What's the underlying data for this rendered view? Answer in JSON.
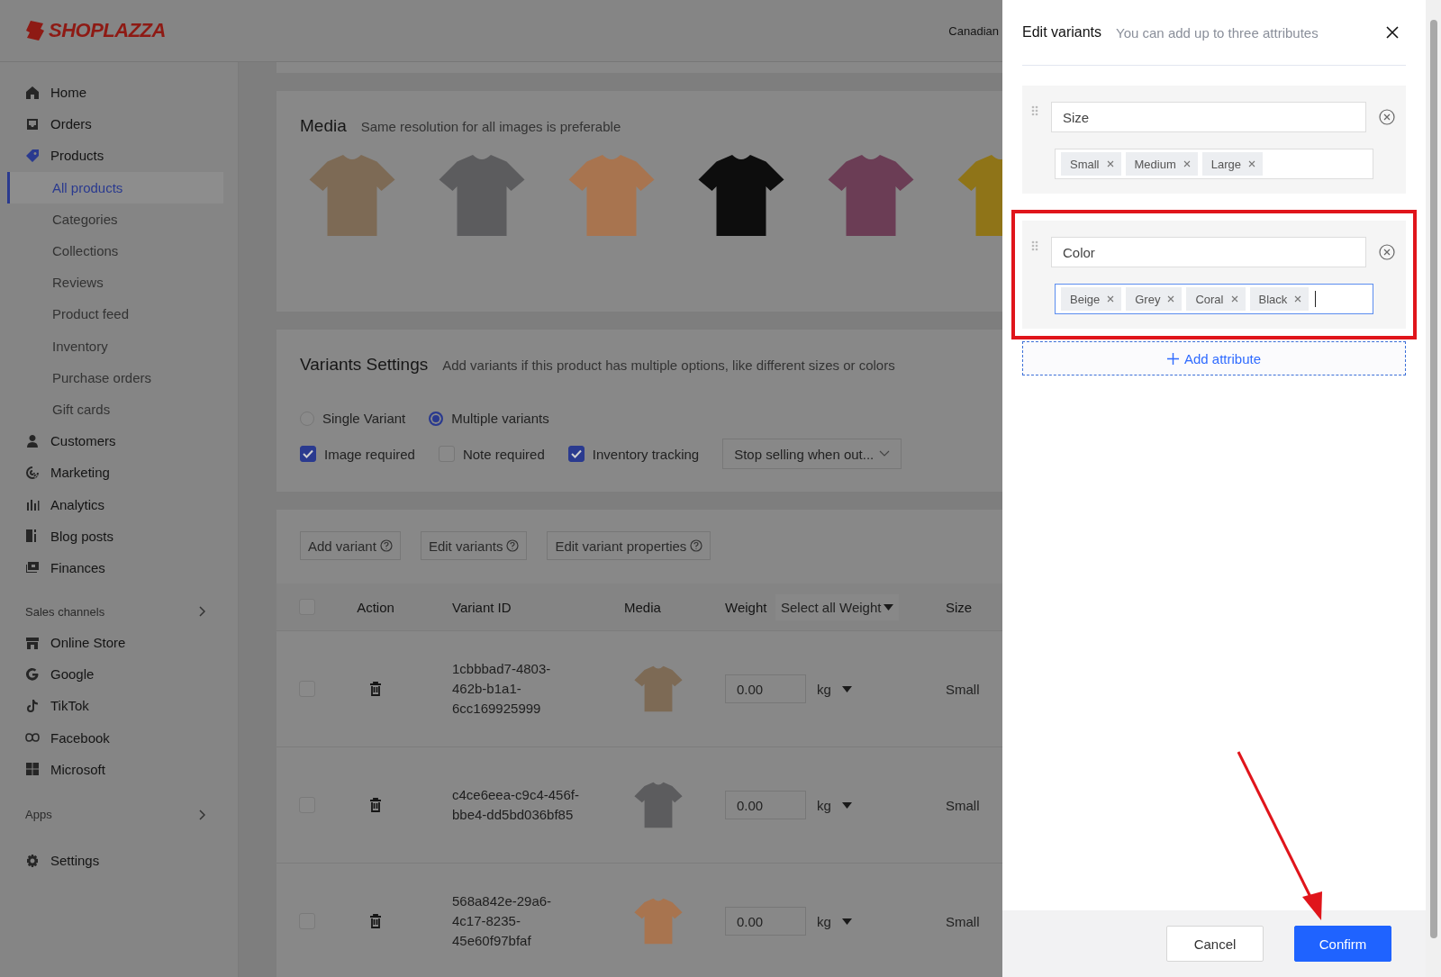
{
  "header": {
    "logo": "SHOPLAZZA",
    "store_name": "Canadian"
  },
  "sidebar": {
    "items": [
      {
        "label": "Home",
        "selected": false
      },
      {
        "label": "Orders",
        "selected": false
      },
      {
        "label": "Products",
        "selected": false,
        "children": [
          {
            "label": "All products",
            "selected": true
          },
          {
            "label": "Categories",
            "selected": false
          },
          {
            "label": "Collections",
            "selected": false
          },
          {
            "label": "Reviews",
            "selected": false
          },
          {
            "label": "Product feed",
            "selected": false
          },
          {
            "label": "Inventory",
            "selected": false
          },
          {
            "label": "Purchase orders",
            "selected": false
          },
          {
            "label": "Gift cards",
            "selected": false
          }
        ]
      },
      {
        "label": "Customers",
        "selected": false
      },
      {
        "label": "Marketing",
        "selected": false
      },
      {
        "label": "Analytics",
        "selected": false
      },
      {
        "label": "Blog posts",
        "selected": false
      },
      {
        "label": "Finances",
        "selected": false
      }
    ],
    "sales_channels": {
      "title": "Sales channels",
      "items": [
        {
          "label": "Online Store",
          "selected": false
        },
        {
          "label": "Google",
          "selected": false
        },
        {
          "label": "TikTok",
          "selected": false
        },
        {
          "label": "Facebook",
          "selected": false
        },
        {
          "label": "Microsoft",
          "selected": false
        }
      ]
    },
    "apps": {
      "title": "Apps"
    },
    "settings": {
      "label": "Settings",
      "selected": false
    }
  },
  "media": {
    "title": "Media",
    "hint": "Same resolution for all images is preferable",
    "images": [
      {
        "color": "#7d6a55"
      },
      {
        "color": "#5c5c5e"
      },
      {
        "color": "#a8744f"
      },
      {
        "color": "#0d0d0d"
      },
      {
        "color": "#6b3d55"
      },
      {
        "color": "#8f7418"
      }
    ]
  },
  "variants_settings": {
    "title": "Variants Settings",
    "hint": "Add variants if this product has multiple options, like different sizes or colors",
    "options": [
      {
        "label": "Single Variant",
        "selected": false
      },
      {
        "label": "Multiple variants",
        "selected": true
      }
    ],
    "flags": [
      {
        "label": "Image required",
        "checked": true
      },
      {
        "label": "Note required",
        "checked": false
      },
      {
        "label": "Inventory tracking",
        "checked": true
      }
    ],
    "out_of_stock": {
      "value": "Stop selling when out..."
    }
  },
  "variant_actions": [
    "Add variant",
    "Edit variants",
    "Edit variant properties"
  ],
  "table": {
    "all_checked": false,
    "columns": [
      "Action",
      "Variant ID",
      "Media",
      "Weight",
      "Select all Weight",
      "Size"
    ],
    "rows": [
      {
        "checked": false,
        "variant_id": "1cbbbad7-4803-462b-b1a1-6cc169925999",
        "weight": "0.00",
        "unit": "kg",
        "size": "Small"
      },
      {
        "checked": false,
        "variant_id": "c4ce6eea-c9c4-456f-bbe4-dd5bd036bf85",
        "weight": "0.00",
        "unit": "kg",
        "size": "Small"
      },
      {
        "checked": false,
        "variant_id": "568a842e-29a6-4c17-8235-45e60f97bfaf",
        "weight": "0.00",
        "unit": "kg",
        "size": "Small"
      }
    ]
  },
  "drawer": {
    "title": "Edit variants",
    "hint": "You can add up to three attributes",
    "attributes": [
      {
        "name": "Size",
        "values": [
          "Small",
          "Medium",
          "Large"
        ],
        "focused": false,
        "highlighted": false
      },
      {
        "name": "Color",
        "values": [
          "Beige",
          "Grey",
          "Coral",
          "Black"
        ],
        "focused": true,
        "highlighted": true
      }
    ],
    "add_label": "Add attribute",
    "buttons": [
      {
        "label": "Cancel",
        "kind": "secondary"
      },
      {
        "label": "Confirm",
        "kind": "primary"
      }
    ]
  },
  "arrow_to_confirm": true
}
